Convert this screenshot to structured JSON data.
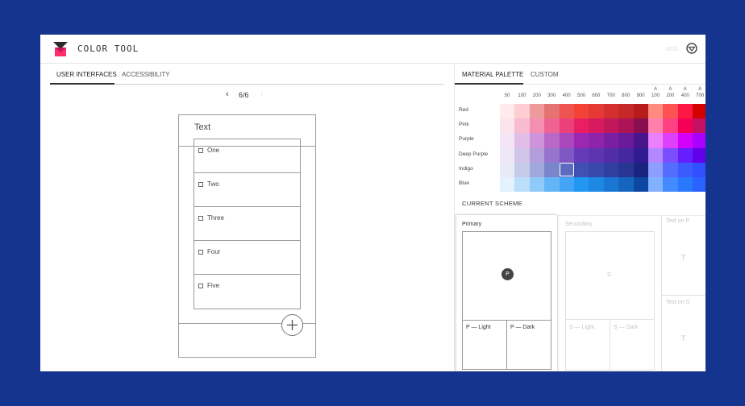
{
  "app": {
    "title": "COLOR TOOL",
    "faint_label": "oco"
  },
  "left_tabs": [
    {
      "label": "USER INTERFACES",
      "active": true
    },
    {
      "label": "ACCESSIBILITY",
      "active": false
    }
  ],
  "pager": {
    "prev": "‹",
    "page": "6/6",
    "next": "›"
  },
  "phone": {
    "title": "Text",
    "items": [
      "One",
      "Two",
      "Three",
      "Four",
      "Five"
    ],
    "fab_icon": "plus-icon"
  },
  "right_tabs": [
    {
      "label": "MATERIAL PALETTE",
      "active": true
    },
    {
      "label": "CUSTOM",
      "active": false
    }
  ],
  "palette": {
    "columns": [
      {
        "top": "",
        "bottom": "50"
      },
      {
        "top": "",
        "bottom": "100"
      },
      {
        "top": "",
        "bottom": "200"
      },
      {
        "top": "",
        "bottom": "300"
      },
      {
        "top": "",
        "bottom": "400"
      },
      {
        "top": "",
        "bottom": "500"
      },
      {
        "top": "",
        "bottom": "600"
      },
      {
        "top": "",
        "bottom": "700"
      },
      {
        "top": "",
        "bottom": "800"
      },
      {
        "top": "",
        "bottom": "900"
      },
      {
        "top": "A",
        "bottom": "100"
      },
      {
        "top": "A",
        "bottom": "200"
      },
      {
        "top": "A",
        "bottom": "400"
      },
      {
        "top": "A",
        "bottom": "700"
      }
    ],
    "rows": [
      {
        "name": "Red",
        "colors": [
          "#FFEBEE",
          "#FFCDD2",
          "#EF9A9A",
          "#E57373",
          "#EF5350",
          "#F44336",
          "#E53935",
          "#D32F2F",
          "#C62828",
          "#B71C1C",
          "#FF8A80",
          "#FF5252",
          "#FF1744",
          "#D50000"
        ]
      },
      {
        "name": "Pink",
        "colors": [
          "#FCE4EC",
          "#F8BBD0",
          "#F48FB1",
          "#F06292",
          "#EC407A",
          "#E91E63",
          "#D81B60",
          "#C2185B",
          "#AD1457",
          "#880E4F",
          "#FF80AB",
          "#FF4081",
          "#F50057",
          "#C51162"
        ]
      },
      {
        "name": "Purple",
        "colors": [
          "#F3E5F5",
          "#E1BEE7",
          "#CE93D8",
          "#BA68C8",
          "#AB47BC",
          "#9C27B0",
          "#8E24AA",
          "#7B1FA2",
          "#6A1B9A",
          "#4A148C",
          "#EA80FC",
          "#E040FB",
          "#D500F9",
          "#AA00FF"
        ]
      },
      {
        "name": "Deep Purple",
        "colors": [
          "#EDE7F6",
          "#D1C4E9",
          "#B39DDB",
          "#9575CD",
          "#7E57C2",
          "#673AB7",
          "#5E35B1",
          "#512DA8",
          "#4527A0",
          "#311B92",
          "#B388FF",
          "#7C4DFF",
          "#651FFF",
          "#6200EA"
        ]
      },
      {
        "name": "Indigo",
        "colors": [
          "#E8EAF6",
          "#C5CAE9",
          "#9FA8DA",
          "#7986CB",
          "#5C6BC0",
          "#3F51B5",
          "#3949AB",
          "#303F9F",
          "#283593",
          "#1A237E",
          "#8C9EFF",
          "#536DFE",
          "#3D5AFE",
          "#304FFE"
        ]
      },
      {
        "name": "Blue",
        "colors": [
          "#E3F2FD",
          "#BBDEFB",
          "#90CAF9",
          "#64B5F6",
          "#42A5F5",
          "#2196F3",
          "#1E88E5",
          "#1976D2",
          "#1565C0",
          "#0D47A1",
          "#82B1FF",
          "#448AFF",
          "#2979FF",
          "#2962FF"
        ]
      }
    ]
  },
  "scheme": {
    "heading": "CURRENT SCHEME",
    "primary": {
      "label": "Primary",
      "badge": "P",
      "light": "P — Light",
      "dark": "P — Dark"
    },
    "secondary": {
      "label": "Secondary",
      "badge": "S",
      "light": "S — Light",
      "dark": "S — Dark"
    },
    "text_on_p": {
      "label": "Text on P",
      "glyph": "T"
    },
    "text_on_s": {
      "label": "Text on S",
      "glyph": "T"
    }
  },
  "colors": {
    "background": "#15348f",
    "logo_dark": "#2a2a2a",
    "logo_pink": "#ff2d6a",
    "primary_badge": "#444444"
  }
}
